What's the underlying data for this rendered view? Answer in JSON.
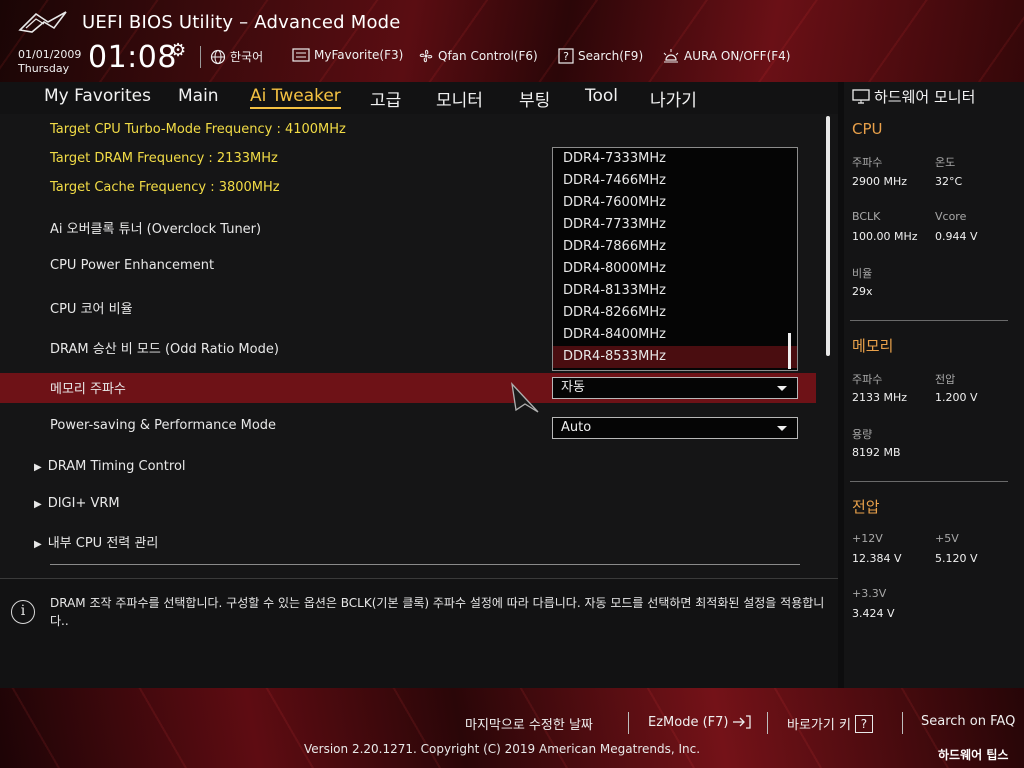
{
  "header": {
    "title": "UEFI BIOS Utility – Advanced Mode",
    "date": "01/01/2009",
    "weekday": "Thursday",
    "time": "01:08"
  },
  "toolbar": {
    "language": "한국어",
    "myfavorite": "MyFavorite(F3)",
    "qfan": "Qfan Control(F6)",
    "search": "Search(F9)",
    "aura": "AURA ON/OFF(F4)"
  },
  "nav": {
    "tabs": [
      "My Favorites",
      "Main",
      "Ai Tweaker",
      "고급",
      "모니터",
      "부팅",
      "Tool",
      "나가기"
    ],
    "active": "Ai Tweaker"
  },
  "main": {
    "target_cpu": "Target CPU Turbo-Mode Frequency : 4100MHz",
    "target_dram": "Target DRAM Frequency : 2133MHz",
    "target_cache": "Target Cache Frequency : 3800MHz",
    "overclock_tuner": "Ai 오버클록 튜너 (Overclock Tuner)",
    "cpu_power": "CPU Power Enhancement",
    "cpu_ratio": "CPU 코어 비율",
    "odd_ratio": "DRAM 승산 비 모드 (Odd Ratio Mode)",
    "memory_freq": "메모리 주파수",
    "memory_freq_value": "자동",
    "power_saving": "Power-saving & Performance Mode",
    "power_saving_value": "Auto",
    "dram_timing": "DRAM Timing Control",
    "digi_vrm": "DIGI+ VRM",
    "internal_cpu": "내부 CPU 전력 관리"
  },
  "dropdown": {
    "options": [
      "DDR4-7333MHz",
      "DDR4-7466MHz",
      "DDR4-7600MHz",
      "DDR4-7733MHz",
      "DDR4-7866MHz",
      "DDR4-8000MHz",
      "DDR4-8133MHz",
      "DDR4-8266MHz",
      "DDR4-8400MHz",
      "DDR4-8533MHz"
    ],
    "selected": "DDR4-8533MHz"
  },
  "info": {
    "text": "DRAM 조작 주파수를 선택합니다. 구성할 수 있는 옵션은 BCLK(기본 클록) 주파수 설정에 따라 다릅니다. 자동 모드를 선택하면 최적화된 설정을 적용합니다.."
  },
  "hw_monitor": {
    "title": "하드웨어 모니터",
    "cpu": {
      "heading": "CPU",
      "freq_label": "주파수",
      "freq": "2900 MHz",
      "temp_label": "온도",
      "temp": "32°C",
      "bclk_label": "BCLK",
      "bclk": "100.00 MHz",
      "vcore_label": "Vcore",
      "vcore": "0.944 V",
      "ratio_label": "비율",
      "ratio": "29x"
    },
    "memory": {
      "heading": "메모리",
      "freq_label": "주파수",
      "freq": "2133 MHz",
      "volt_label": "전압",
      "volt": "1.200 V",
      "cap_label": "용량",
      "cap": "8192 MB"
    },
    "voltage": {
      "heading": "전압",
      "v12_label": "+12V",
      "v12": "12.384 V",
      "v5_label": "+5V",
      "v5": "5.120 V",
      "v33_label": "+3.3V",
      "v33": "3.424 V"
    }
  },
  "footer": {
    "last_modified": "마지막으로 수정한 날짜",
    "ezmode": "EzMode (F7)",
    "hotkeys": "바로가기 키",
    "faq": "Search on FAQ",
    "copyright": "Version 2.20.1271. Copyright (C) 2019 American Megatrends, Inc.",
    "watermark": "하드웨어 팁스"
  },
  "colors": {
    "accent_yellow": "#f5c242",
    "highlight_red": "#6e1217",
    "section_orange": "#e8a04a"
  }
}
